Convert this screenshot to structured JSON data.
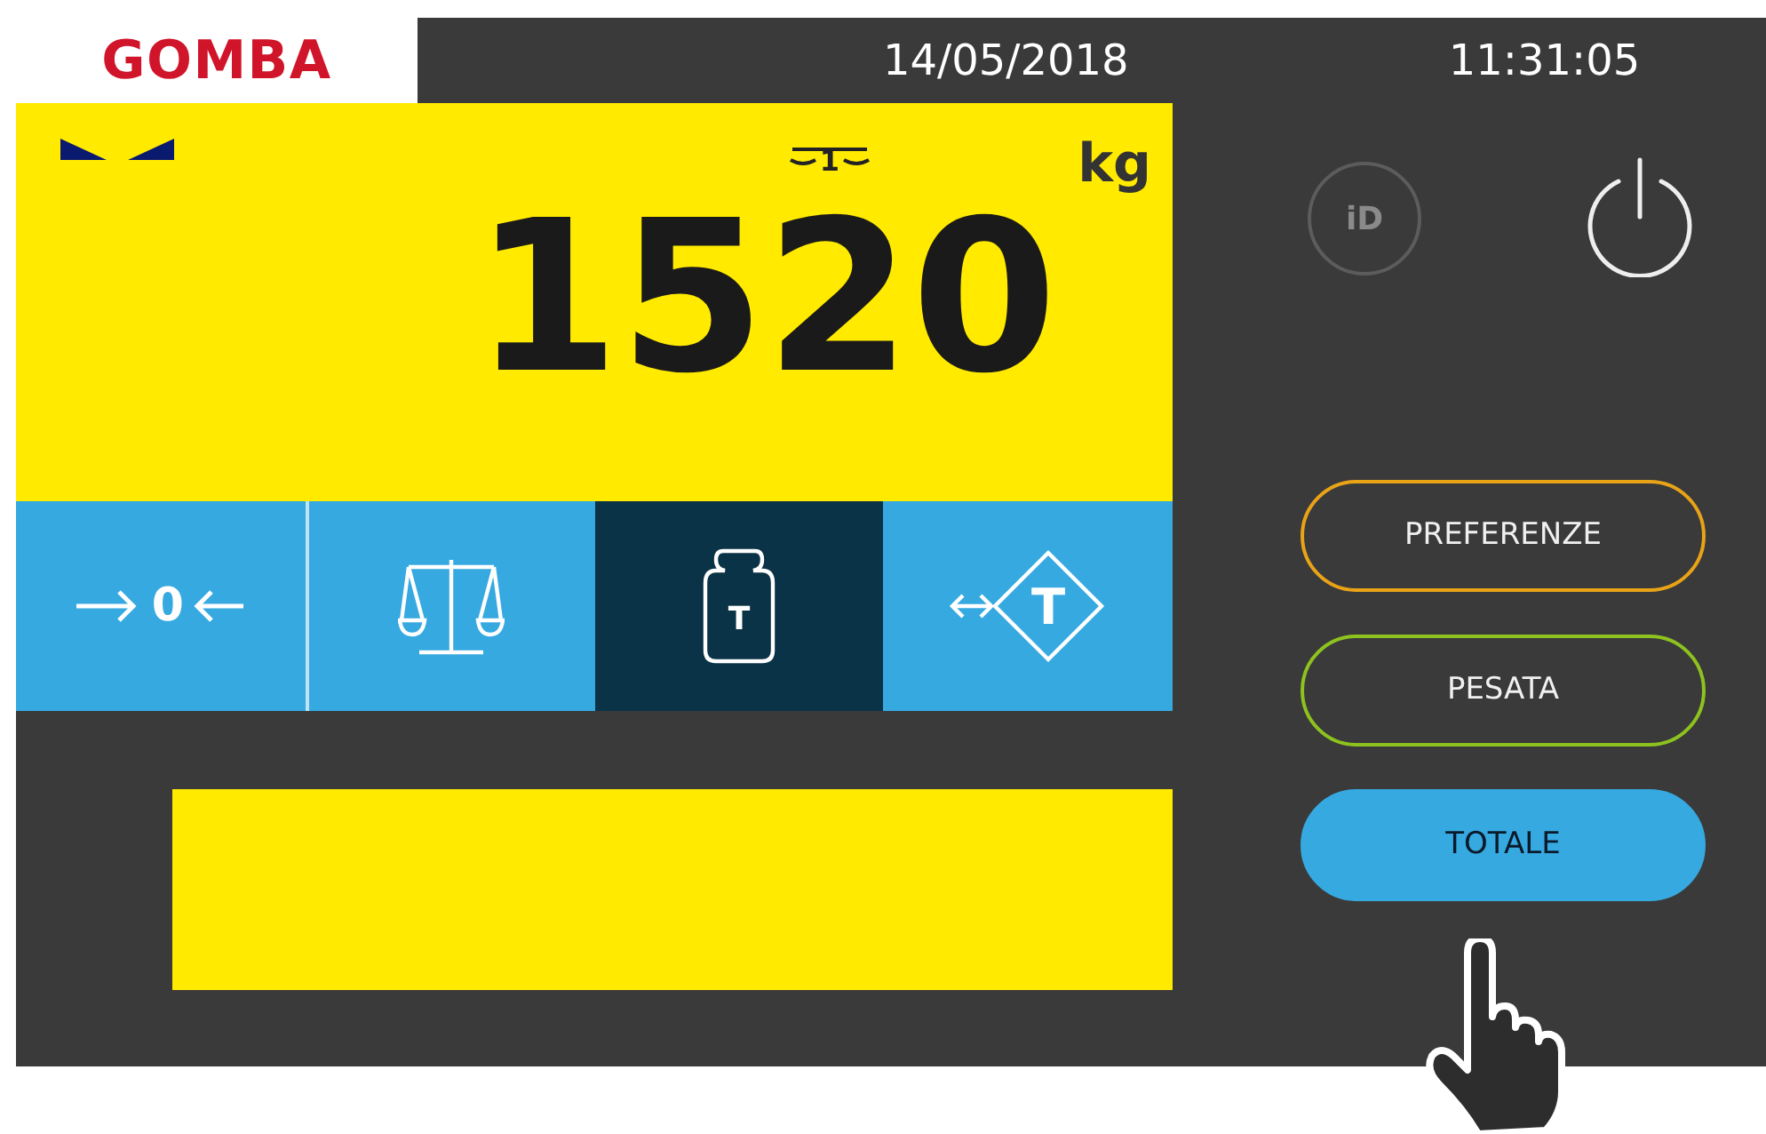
{
  "header": {
    "logo": "GOMBA",
    "date": "14/05/2018",
    "time": "11:31:05"
  },
  "display": {
    "range": "1",
    "unit": "kg",
    "weight": "1520"
  },
  "function_keys": [
    {
      "kind": "zero",
      "label": "0",
      "selected": false
    },
    {
      "kind": "weigh",
      "selected": false
    },
    {
      "kind": "tare",
      "label": "T",
      "selected": true
    },
    {
      "kind": "preset_tare",
      "label": "T",
      "selected": false
    }
  ],
  "id_button": {
    "label": "iD"
  },
  "menu_buttons": [
    {
      "label": "PREFERENZE",
      "color": "#e8a317",
      "selected": false
    },
    {
      "label": "PESATA",
      "color": "#8dc21f",
      "selected": false
    },
    {
      "label": "TOTALE",
      "color": "#36a9e1",
      "selected": true
    }
  ]
}
